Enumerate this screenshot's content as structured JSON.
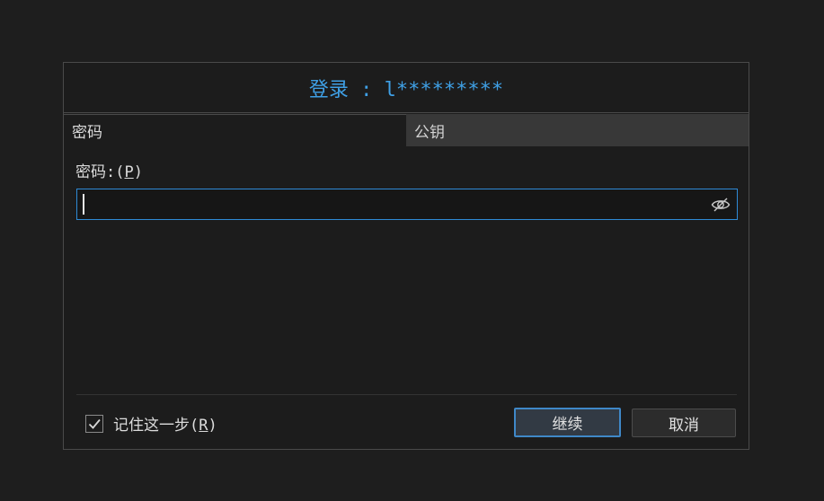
{
  "dialog": {
    "title": "登录 : l*********"
  },
  "tabs": [
    {
      "label": "密码",
      "active": true
    },
    {
      "label": "公钥",
      "active": false
    }
  ],
  "password": {
    "label_prefix": "密码:(",
    "label_mnemonic": "P",
    "label_suffix": ")",
    "value": "",
    "toggle_icon": "eye-slash-icon"
  },
  "remember": {
    "checked": true,
    "label_prefix": "记住这一步(",
    "label_mnemonic": "R",
    "label_suffix": ")"
  },
  "buttons": {
    "continue_label": "继续",
    "cancel_label": "取消"
  },
  "colors": {
    "title": "#3fa0e6",
    "focus_border": "#2e8ad6",
    "background": "#1e1e1e"
  }
}
